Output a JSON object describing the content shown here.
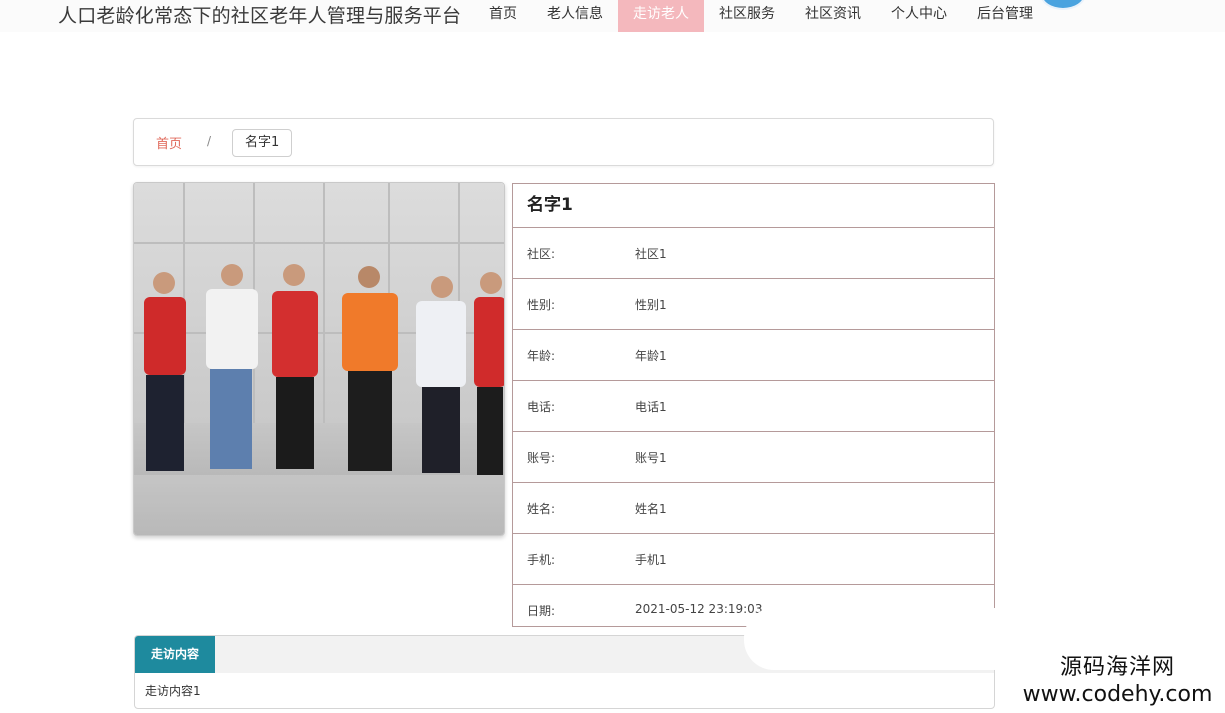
{
  "header": {
    "site_title": "人口老龄化常态下的社区老年人管理与服务平台",
    "nav": [
      {
        "label": "首页",
        "active": false
      },
      {
        "label": "老人信息",
        "active": false
      },
      {
        "label": "走访老人",
        "active": true
      },
      {
        "label": "社区服务",
        "active": false
      },
      {
        "label": "社区资讯",
        "active": false
      },
      {
        "label": "个人中心",
        "active": false
      },
      {
        "label": "后台管理",
        "active": false
      }
    ]
  },
  "breadcrumb": {
    "home": "首页",
    "separator": "/",
    "current": "名字1"
  },
  "detail": {
    "title": "名字1",
    "rows": [
      {
        "label": "社区:",
        "value": "社区1"
      },
      {
        "label": "性别:",
        "value": "性别1"
      },
      {
        "label": "年龄:",
        "value": "年龄1"
      },
      {
        "label": "电话:",
        "value": "电话1"
      },
      {
        "label": "账号:",
        "value": "账号1"
      },
      {
        "label": "姓名:",
        "value": "姓名1"
      },
      {
        "label": "手机:",
        "value": "手机1"
      },
      {
        "label": "日期:",
        "value": "2021-05-12 23:19:03"
      }
    ]
  },
  "visit": {
    "tab_label": "走访内容",
    "content": "走访内容1"
  },
  "watermark": {
    "cn": "源码海洋网",
    "en": "www.codehy.com"
  },
  "colors": {
    "nav_active_bg": "#f4b8bd",
    "tab_bg": "#1e8a9e",
    "breadcrumb_home": "#e06a5b",
    "table_border": "#b59a9a"
  }
}
